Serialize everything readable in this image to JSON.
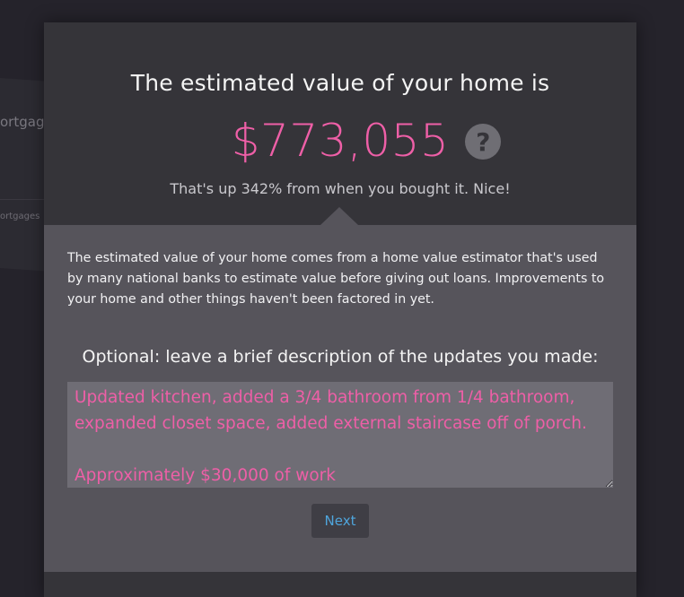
{
  "background": {
    "nav_label_1": "ortgage",
    "nav_label_2": "ortgages"
  },
  "modal": {
    "headline": "The estimated value of your home is",
    "estimated_value": "$773,055",
    "help_icon": "question-mark-icon",
    "change_text": "That's up 342% from when you bought it. Nice!",
    "info_text": "The estimated value of your home comes from a home value estimator that's used by many national banks to estimate value before giving out loans. Improvements to your home and other things haven't been factored in yet.",
    "optional_label": "Optional: leave a brief description of the updates you made:",
    "updates_value": "Updated kitchen, added a 3/4 bathroom from 1/4 bathroom, expanded closet space, added external staircase off of porch.\n\nApproximately $30,000 of work",
    "next_label": "Next"
  },
  "colors": {
    "accent_pink": "#ee5fa7",
    "link_blue": "#4fa5dc",
    "modal_dark": "#353439",
    "panel_gray": "#56545b"
  }
}
